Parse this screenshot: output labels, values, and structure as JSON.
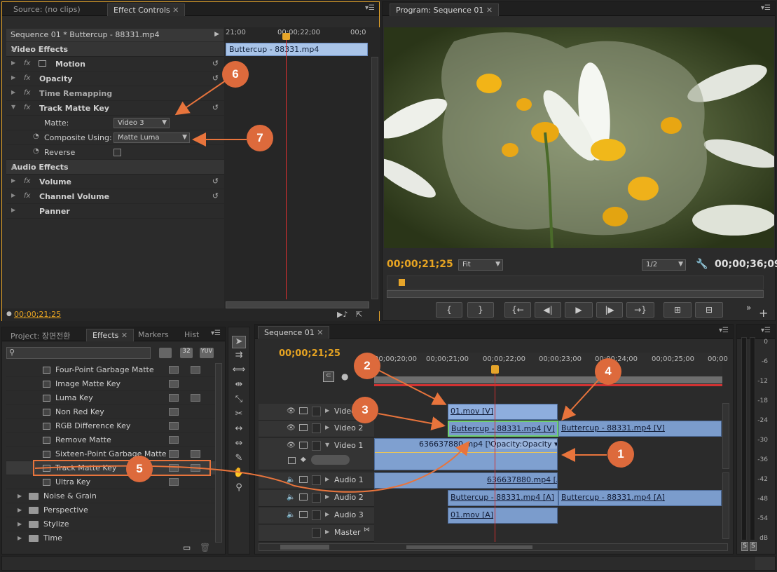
{
  "effect_controls": {
    "tabs": [
      "Source: (no clips)",
      "Effect Controls"
    ],
    "sequence_label": "Sequence 01 * Buttercup - 88331.mp4",
    "ruler_left": "21;00",
    "ruler_mid": "00;00;22;00",
    "ruler_right": "00;0",
    "clip_name": "Buttercup - 88331.mp4",
    "video_effects_label": "Video Effects",
    "effects": [
      "Motion",
      "Opacity",
      "Time Remapping",
      "Track Matte Key"
    ],
    "matte_label": "Matte:",
    "matte_value": "Video 3",
    "composite_label": "Composite Using:",
    "composite_value": "Matte Luma",
    "reverse_label": "Reverse",
    "audio_effects_label": "Audio Effects",
    "audio_effects": [
      "Volume",
      "Channel Volume",
      "Panner"
    ],
    "timecode": "00;00;21;25"
  },
  "program": {
    "tab": "Program: Sequence 01",
    "timecode_left": "00;00;21;25",
    "fit": "Fit",
    "resolution": "1/2",
    "timecode_right": "00;00;36;09",
    "transport": [
      "{",
      "}",
      "{←",
      "◀|",
      "▶",
      "|▶",
      "→}",
      "⊞",
      "⊟"
    ]
  },
  "project_panel": {
    "tabs": [
      "Project: 장면전환",
      "Effects",
      "Markers",
      "Hist"
    ],
    "search_placeholder": "",
    "badges": [
      "32",
      "YUV"
    ],
    "effects_list": [
      {
        "name": "Four-Point Garbage Matte",
        "b32": true
      },
      {
        "name": "Image Matte Key",
        "b32": false
      },
      {
        "name": "Luma Key",
        "b32": true
      },
      {
        "name": "Non Red Key",
        "b32": false
      },
      {
        "name": "RGB Difference Key",
        "b32": false
      },
      {
        "name": "Remove Matte",
        "b32": false
      },
      {
        "name": "Sixteen-Point Garbage Matte",
        "b32": true
      },
      {
        "name": "Track Matte Key",
        "b32": true
      },
      {
        "name": "Ultra Key",
        "b32": false
      }
    ],
    "folders": [
      "Noise & Grain",
      "Perspective",
      "Stylize",
      "Time"
    ]
  },
  "timeline": {
    "tab": "Sequence 01",
    "timecode": "00;00;21;25",
    "ruler": [
      "00;00;20;00",
      "00;00;21;00",
      "00;00;22;00",
      "00;00;23;00",
      "00;00;24;00",
      "00;00;25;00",
      "00;00"
    ],
    "tracks": [
      "Video 3",
      "Video 2",
      "Video 1",
      "Audio 1",
      "Audio 2",
      "Audio 3",
      "Master"
    ],
    "clips": {
      "v3": "01.mov [V]",
      "v2a": "Buttercup - 88331.mp4 [V]",
      "v2b": "Buttercup - 88331.mp4 [V]",
      "v1": "636637880.mp4 [V]",
      "v1_opacity": "Opacity:Opacity",
      "a1": "636637880.mp4 [A]",
      "a2a": "Buttercup - 88331.mp4 [A]",
      "a2b": "Buttercup - 88331.mp4 [A]",
      "a3": "01.mov [A]"
    }
  },
  "meter": {
    "labels": [
      "0",
      "-6",
      "-12",
      "-18",
      "-24",
      "-30",
      "-36",
      "-42",
      "-48",
      "-54",
      "dB"
    ],
    "solo": [
      "S",
      "S"
    ]
  },
  "callouts": [
    "1",
    "2",
    "3",
    "4",
    "5",
    "6",
    "7"
  ]
}
